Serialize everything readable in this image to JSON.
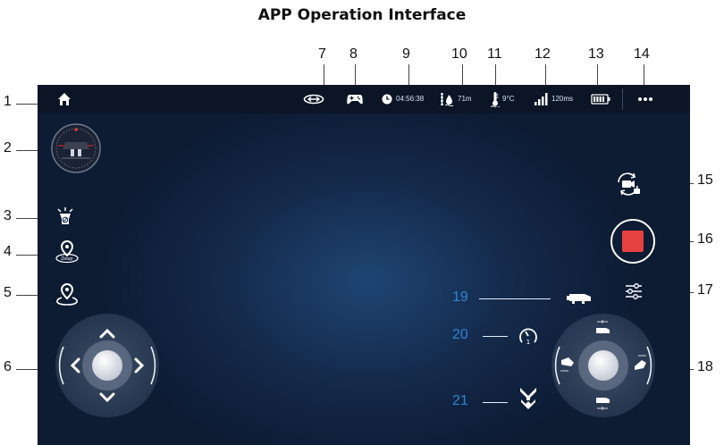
{
  "title": "APP Operation Interface",
  "status": {
    "time": "04:56:38",
    "depth": "71m",
    "temperature": "9°C",
    "latency": "120ms"
  },
  "callouts": {
    "c1": "1",
    "c2": "2",
    "c3": "3",
    "c4": "4",
    "c5": "5",
    "c6": "6",
    "c7": "7",
    "c8": "8",
    "c9": "9",
    "c10": "10",
    "c11": "11",
    "c12": "12",
    "c13": "13",
    "c14": "14",
    "c15": "15",
    "c16": "16",
    "c17": "17",
    "c18": "18",
    "c19": "19",
    "c20": "20",
    "c21": "21"
  },
  "colors": {
    "screen_bg": "#14294a",
    "status_bg": "#0b1526",
    "record": "#e84141",
    "callout_blue": "#2a86d4",
    "icon": "#ffffff"
  },
  "icons": {
    "home": "home-icon",
    "compass": "compass-icon",
    "light": "light-icon",
    "deep": "deep-location-icon",
    "location": "location-icon",
    "link": "link-icon",
    "gamepad": "gamepad-icon",
    "clock": "clock-icon",
    "depth": "depth-icon",
    "thermometer": "thermometer-icon",
    "signal": "signal-icon",
    "battery": "battery-icon",
    "more": "more-icon",
    "camera_switch": "camera-switch-icon",
    "record": "record-icon",
    "settings": "sliders-icon",
    "robot": "robot-icon",
    "speed": "speed-icon",
    "claw": "claw-icon"
  },
  "labels": {
    "deep": "Deep"
  }
}
